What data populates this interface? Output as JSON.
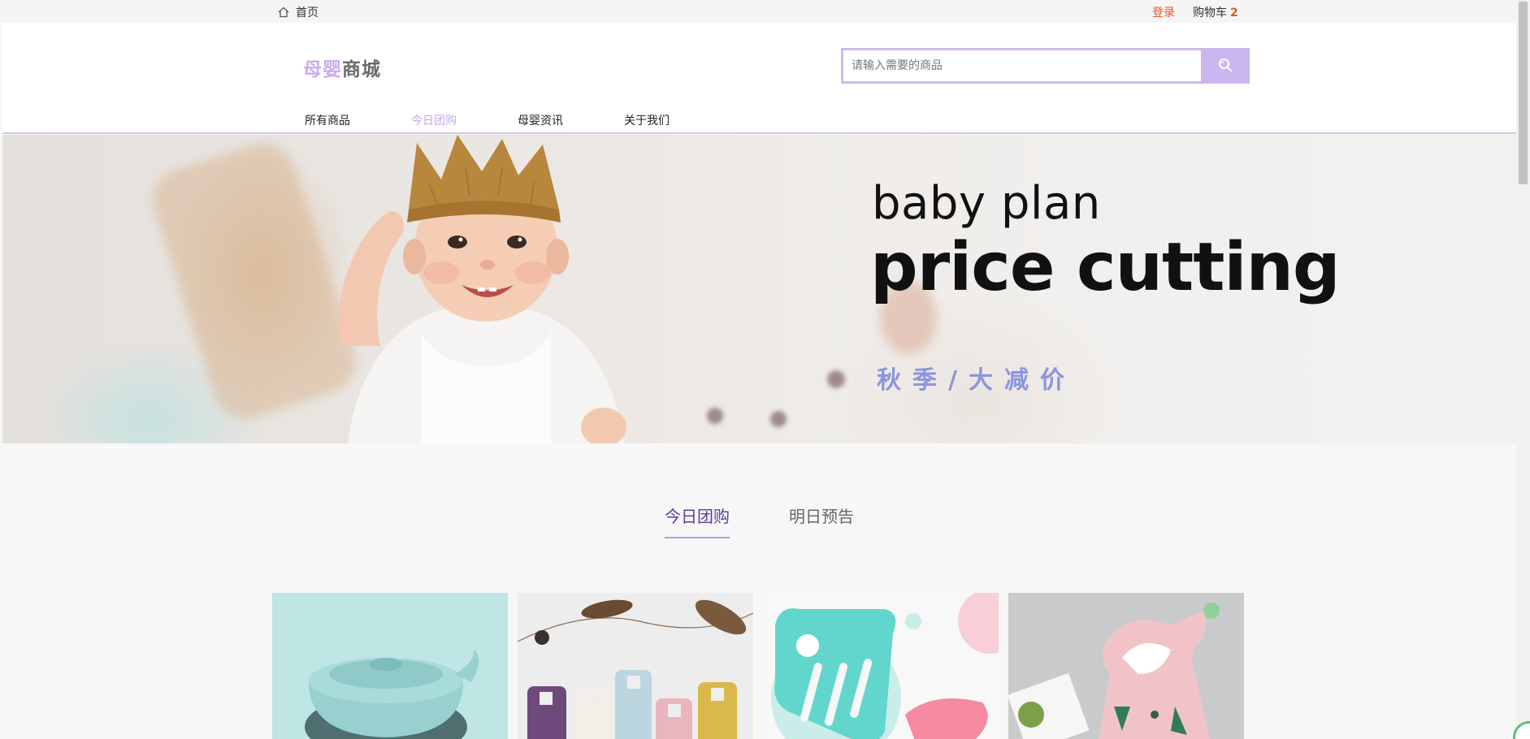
{
  "topbar": {
    "home_label": "首页",
    "login_label": "登录",
    "cart_label": "购物车",
    "cart_count": "2"
  },
  "header": {
    "logo_part1": "母婴",
    "logo_part2": "商城",
    "search_placeholder": "请输入需要的商品",
    "search_icon": "search-icon"
  },
  "nav": {
    "items": [
      {
        "label": "所有商品",
        "active": false
      },
      {
        "label": "今日团购",
        "active": true
      },
      {
        "label": "母婴资讯",
        "active": false
      },
      {
        "label": "关于我们",
        "active": false
      }
    ]
  },
  "banner": {
    "line1": "baby plan",
    "line2": "price cutting",
    "line3": "秋季/大减价"
  },
  "tabs": [
    {
      "label": "今日团购",
      "active": true
    },
    {
      "label": "明日预告",
      "active": false
    }
  ],
  "colors": {
    "accent": "#cbb6ef",
    "accent_text": "#c3a6ea",
    "login_orange": "#e8541e",
    "banner_subtitle": "#8a95de"
  }
}
